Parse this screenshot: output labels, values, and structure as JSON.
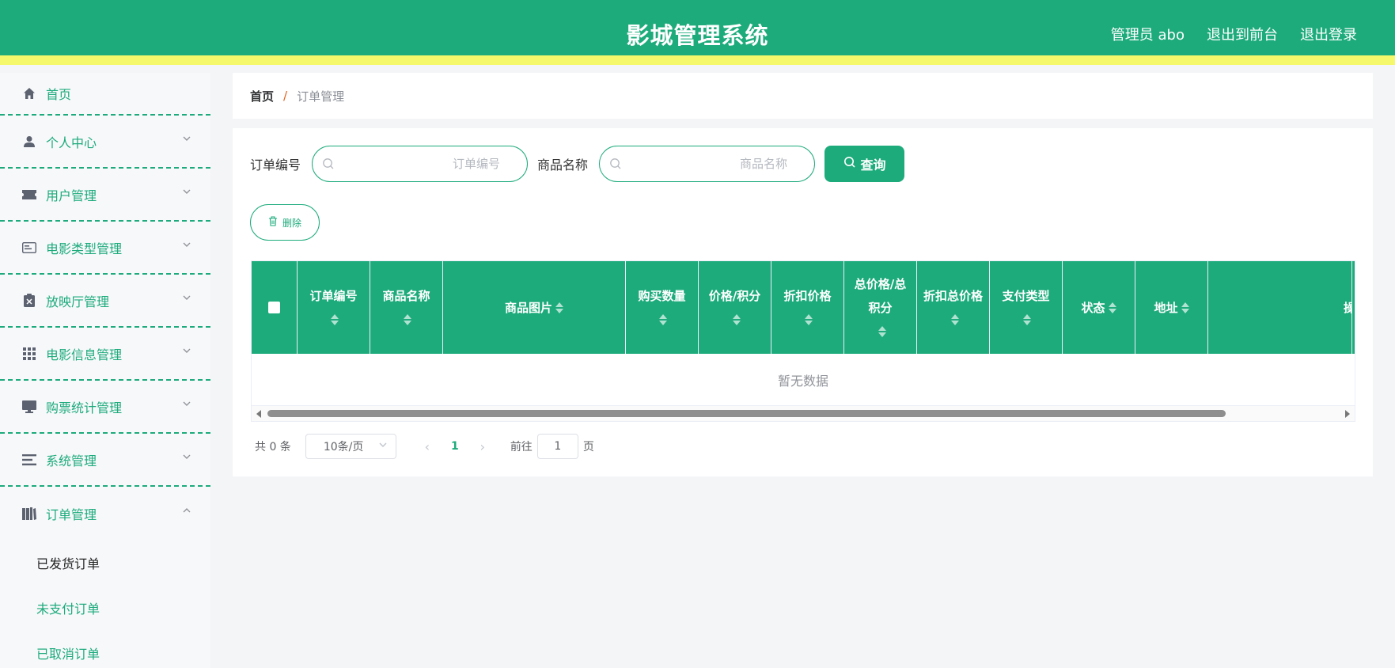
{
  "header": {
    "title": "影城管理系统",
    "admin": "管理员 abo",
    "to_front": "退出到前台",
    "logout": "退出登录"
  },
  "colors": {
    "brand": "#1dab7c",
    "stripe": "#f4f86a",
    "breadcrumb_sep": "#e3631f"
  },
  "sidebar": {
    "items": [
      {
        "label": "首页",
        "icon": "home-icon"
      },
      {
        "label": "个人中心",
        "icon": "user-icon"
      },
      {
        "label": "用户管理",
        "icon": "ticket-icon"
      },
      {
        "label": "电影类型管理",
        "icon": "id-card-icon"
      },
      {
        "label": "放映厅管理",
        "icon": "clipboard-icon"
      },
      {
        "label": "电影信息管理",
        "icon": "grid-icon"
      },
      {
        "label": "购票统计管理",
        "icon": "monitor-icon"
      },
      {
        "label": "系统管理",
        "icon": "list-icon"
      },
      {
        "label": "订单管理",
        "icon": "books-icon"
      }
    ],
    "submenu": [
      "已发货订单",
      "未支付订单",
      "已取消订单"
    ]
  },
  "breadcrumb": {
    "home": "首页",
    "sep": "/",
    "current": "订单管理"
  },
  "search": {
    "order_no_label": "订单编号",
    "order_no_placeholder": "订单编号",
    "product_label": "商品名称",
    "product_placeholder": "商品名称",
    "query_button": "查询"
  },
  "actions": {
    "delete_button": "删除"
  },
  "table": {
    "columns": [
      "订单编号",
      "商品名称",
      "商品图片",
      "购买数量",
      "价格/积分",
      "折扣价格",
      "总价格/总积分",
      "折扣总价格",
      "支付类型",
      "状态",
      "地址",
      "操作"
    ],
    "empty_text": "暂无数据"
  },
  "pagination": {
    "total": "共 0 条",
    "page_size": "10条/页",
    "prev": "‹",
    "next": "›",
    "current_page": "1",
    "goto_label": "前往",
    "goto_value": "1",
    "page_unit": "页"
  }
}
